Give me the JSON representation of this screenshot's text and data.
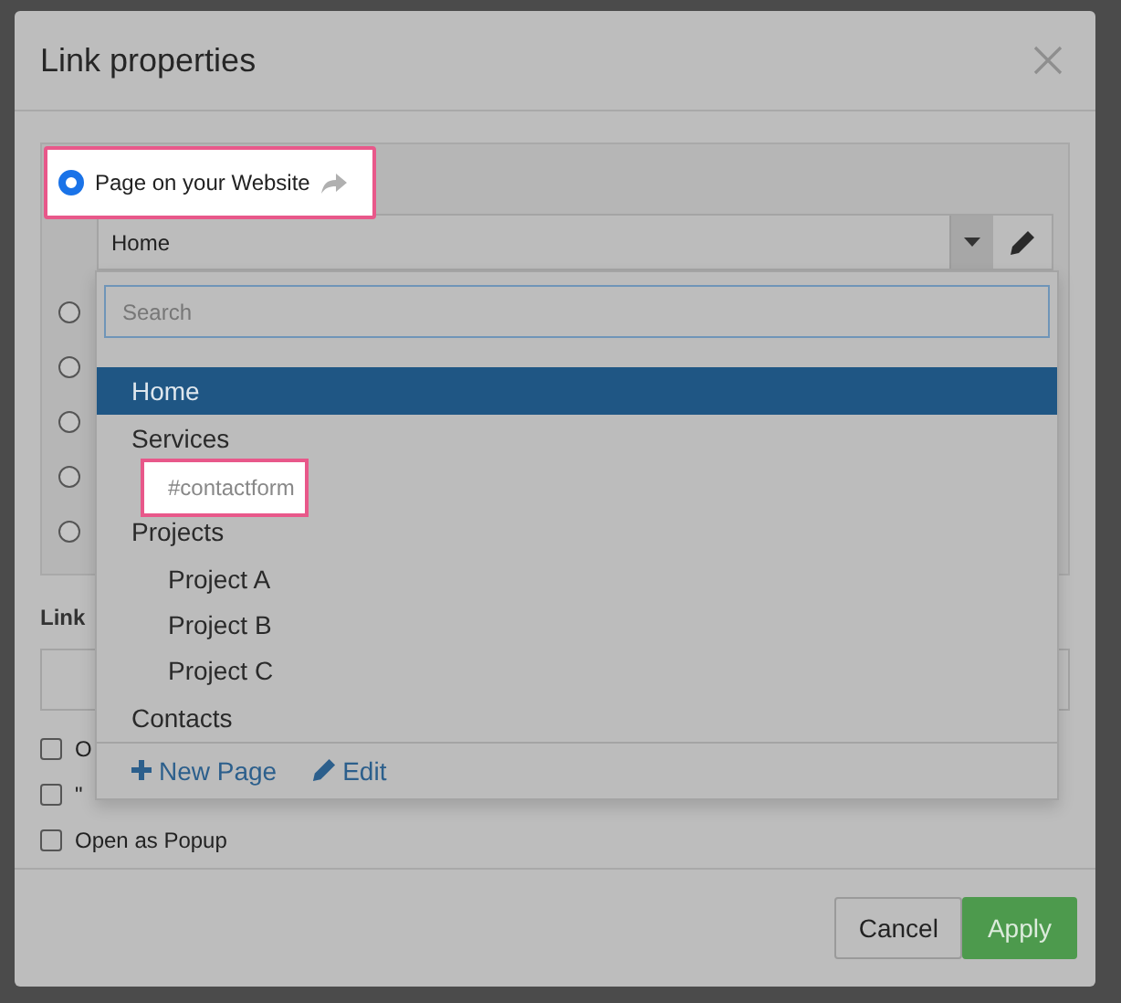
{
  "dialog": {
    "title": "Link properties"
  },
  "link_types": [
    {
      "label": "Page on your Website",
      "selected": true,
      "highlighted": true
    },
    {
      "selected": false
    },
    {
      "selected": false
    },
    {
      "selected": false
    },
    {
      "selected": false
    },
    {
      "selected": false
    }
  ],
  "page_select": {
    "value": "Home"
  },
  "dropdown": {
    "search_placeholder": "Search",
    "pages": [
      {
        "label": "Home",
        "selected": true
      },
      {
        "label": "Services",
        "selected": false,
        "children": [
          {
            "label": "#contactform",
            "selected": false,
            "highlighted": true
          }
        ]
      },
      {
        "label": "Projects",
        "selected": false,
        "children": [
          {
            "label": "Project A",
            "selected": false
          },
          {
            "label": "Project B",
            "selected": false
          },
          {
            "label": "Project C",
            "selected": false
          }
        ]
      },
      {
        "label": "Contacts",
        "selected": false
      }
    ],
    "actions": [
      {
        "label": "New Page",
        "kind": "new"
      },
      {
        "label": "Edit",
        "kind": "edit"
      }
    ]
  },
  "link_text_label": "Link",
  "options": [
    {
      "label": "O",
      "checked": false
    },
    {
      "label": "\"",
      "checked": false
    },
    {
      "label": "Open as Popup",
      "checked": false
    }
  ],
  "buttons": [
    {
      "label": "Cancel",
      "kind": "secondary"
    },
    {
      "label": "Apply",
      "kind": "primary"
    }
  ]
}
